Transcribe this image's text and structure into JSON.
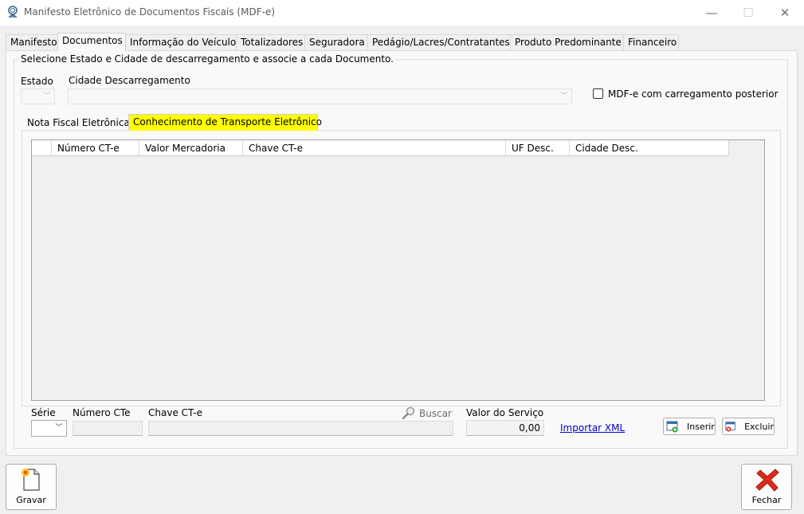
{
  "window": {
    "title": "Manifesto Eletrônico de Documentos Fiscais (MDF-e)",
    "minimize_glyph": "—",
    "maximize_glyph": "☐",
    "close_glyph": "✕"
  },
  "tabs": [
    {
      "label": "Manifesto"
    },
    {
      "label": "Documentos"
    },
    {
      "label": "Informação do Veículo"
    },
    {
      "label": "Totalizadores"
    },
    {
      "label": "Seguradora"
    },
    {
      "label": "Pedágio/Lacres/Contratantes"
    },
    {
      "label": "Produto Predominante"
    },
    {
      "label": "Financeiro"
    }
  ],
  "active_tab": "Documentos",
  "group": {
    "legend": "Selecione Estado e Cidade de descarregamento e associe a cada Documento.",
    "estado_label": "Estado",
    "estado_value": "",
    "cidade_label": "Cidade Descarregamento",
    "cidade_value": "",
    "checkbox_label": "MDF-e com carregamento posterior",
    "checkbox_checked": false
  },
  "inner_tabs": [
    {
      "label": "Nota Fiscal Eletrônica"
    },
    {
      "label": "Conhecimento de Transporte Eletrônico"
    }
  ],
  "active_inner_tab": "Conhecimento de Transporte Eletrônico",
  "highlight_color": "#ffff00",
  "grid": {
    "columns": [
      "Número CT-e",
      "Valor Mercadoria",
      "Chave CT-e",
      "UF Desc.",
      "Cidade Desc."
    ],
    "rows": []
  },
  "form": {
    "serie_label": "Série",
    "numero_label": "Número CTe",
    "chave_label": "Chave CT-e",
    "buscar_label": "Buscar",
    "valor_label": "Valor do Serviço",
    "valor_value": "0,00",
    "importar_label": "Importar XML",
    "inserir_label": "Inserir",
    "excluir_label": "Excluir"
  },
  "footer": {
    "gravar_label": "Gravar",
    "fechar_label": "Fechar"
  },
  "icons": {
    "app": "fingerprint-person-icon",
    "buscar": "magnifier-icon",
    "inserir": "window-add-icon",
    "excluir": "window-delete-icon",
    "gravar": "new-document-icon",
    "fechar": "red-x-icon"
  }
}
